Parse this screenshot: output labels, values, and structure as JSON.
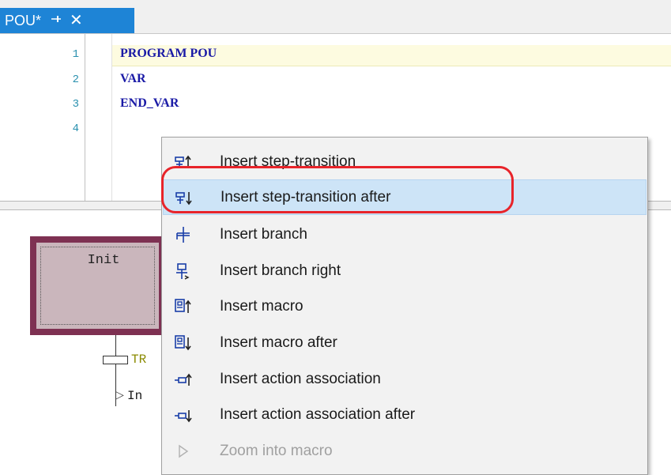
{
  "tab": {
    "title": "POU*",
    "pin_icon": "⊣",
    "close_icon": "✕"
  },
  "editor": {
    "lines": [
      {
        "num": "1",
        "code": "PROGRAM POU"
      },
      {
        "num": "2",
        "code": "VAR"
      },
      {
        "num": "3",
        "code": "END_VAR"
      },
      {
        "num": "4",
        "code": ""
      }
    ]
  },
  "sfc": {
    "init_step_label": "Init",
    "transition_label": "TR",
    "action_label": "In"
  },
  "context_menu": {
    "items": [
      {
        "label": "Insert step-transition",
        "icon": "step-transition-before-icon"
      },
      {
        "label": "Insert step-transition after",
        "icon": "step-transition-after-icon",
        "selected": true
      },
      {
        "label": "Insert branch",
        "icon": "branch-icon"
      },
      {
        "label": "Insert branch right",
        "icon": "branch-right-icon"
      },
      {
        "label": "Insert macro",
        "icon": "macro-before-icon"
      },
      {
        "label": "Insert macro after",
        "icon": "macro-after-icon"
      },
      {
        "label": "Insert action association",
        "icon": "action-association-before-icon"
      },
      {
        "label": "Insert action association after",
        "icon": "action-association-after-icon"
      },
      {
        "label": "Zoom into macro",
        "icon": "zoom-into-macro-icon",
        "disabled": true
      }
    ]
  },
  "colors": {
    "tab_bg": "#1e84d6",
    "selected_item": "#cde4f7",
    "annotation": "#e8242a",
    "step_border": "#7e3152"
  }
}
